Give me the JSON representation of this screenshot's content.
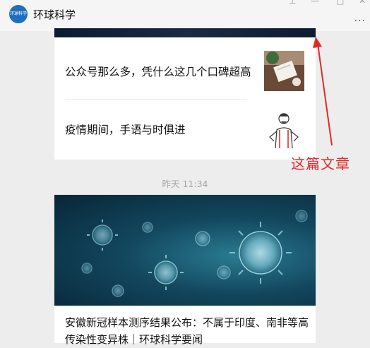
{
  "header": {
    "avatar_text": "环球科学",
    "title": "环球科学"
  },
  "articles_top": [
    {
      "title": "公众号那么多，凭什么这几个口碑超高"
    },
    {
      "title": "疫情期间，手语与时俱进"
    }
  ],
  "timestamp": "昨天 11:34",
  "article_main": {
    "title": "安徽新冠样本测序结果公布：不属于印度、南非等高传染性变异株｜环球科学要闻"
  },
  "annotation": {
    "label": "这篇文章",
    "color": "#e02a2a"
  }
}
